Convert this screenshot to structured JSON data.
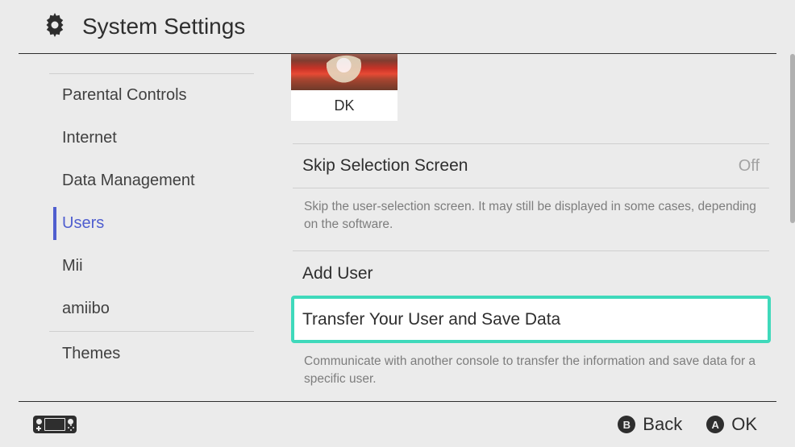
{
  "header": {
    "title": "System Settings"
  },
  "sidebar": {
    "items": [
      {
        "label": "Parental Controls"
      },
      {
        "label": "Internet"
      },
      {
        "label": "Data Management"
      },
      {
        "label": "Users"
      },
      {
        "label": "Mii"
      },
      {
        "label": "amiibo"
      },
      {
        "label": "Themes"
      }
    ],
    "selected_index": 3
  },
  "main": {
    "user": {
      "name": "DK"
    },
    "skip": {
      "label": "Skip Selection Screen",
      "value": "Off",
      "desc": "Skip the user-selection screen. It may still be displayed in some cases, depending on the software."
    },
    "add_user": {
      "label": "Add User"
    },
    "transfer": {
      "label": "Transfer Your User and Save Data",
      "desc": "Communicate with another console to transfer the information and save data for a specific user."
    }
  },
  "footer": {
    "back": {
      "glyph": "B",
      "label": "Back"
    },
    "ok": {
      "glyph": "A",
      "label": "OK"
    }
  }
}
